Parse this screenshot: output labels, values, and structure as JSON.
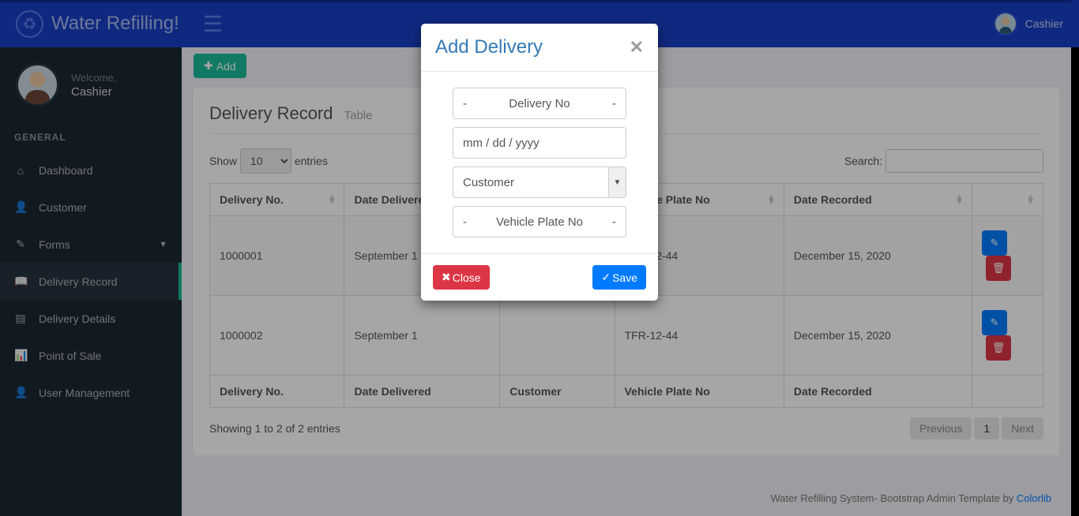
{
  "header": {
    "title": "Water Refilling!",
    "user_label": "Cashier"
  },
  "sidebar": {
    "welcome": "Welcome,",
    "role": "Cashier",
    "section": "GENERAL",
    "items": [
      {
        "label": "Dashboard"
      },
      {
        "label": "Customer"
      },
      {
        "label": "Forms"
      },
      {
        "label": "Delivery Record"
      },
      {
        "label": "Delivery Details"
      },
      {
        "label": "Point of Sale"
      },
      {
        "label": "User Management"
      }
    ]
  },
  "toolbar": {
    "add_label": "Add"
  },
  "panel": {
    "title": "Delivery Record",
    "subtitle": "Table",
    "show_label": "Show",
    "entries_label": "entries",
    "entries_value": "10",
    "search_label": "Search:",
    "columns": [
      "Delivery No.",
      "Date Delivered",
      "Customer",
      "Vehicle Plate No",
      "Date Recorded",
      ""
    ],
    "rows": [
      {
        "no": "1000001",
        "date_del": "September 1",
        "customer": "",
        "plate": "TFR-12-44",
        "date_rec": "December 15, 2020"
      },
      {
        "no": "1000002",
        "date_del": "September 1",
        "customer": "",
        "plate": "TFR-12-44",
        "date_rec": "December 15, 2020"
      }
    ],
    "info": "Showing 1 to 2 of 2 entries",
    "prev": "Previous",
    "page": "1",
    "next": "Next"
  },
  "modal": {
    "title": "Add Delivery",
    "field_delivery_no": "Delivery No",
    "field_date": "mm / dd / yyyy",
    "field_customer": "Customer",
    "field_plate": "Vehicle Plate No",
    "close_label": "Close",
    "save_label": "Save"
  },
  "footer": {
    "text_a": "Water Refilling System- Bootstrap Admin Template by ",
    "text_b": "Colorlib"
  }
}
